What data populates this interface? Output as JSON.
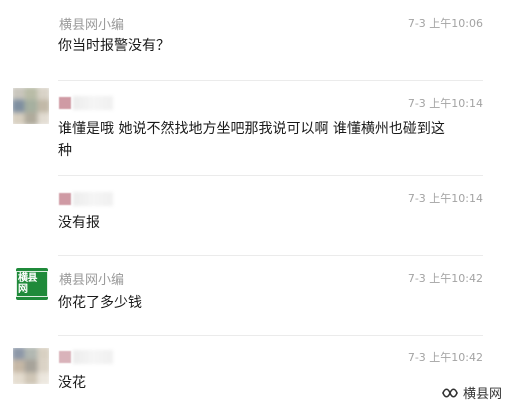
{
  "comments": [
    {
      "author": "横县网小编",
      "author_blurred": false,
      "time": "7-3 上午10:06",
      "text": "你当时报警没有？",
      "avatar": "none"
    },
    {
      "author": "",
      "author_blurred": true,
      "time": "7-3 上午10:14",
      "text": "谁懂是哦  她说不然找地方坐吧那我说可以啊  谁懂横州也碰到这种",
      "avatar": "blurred-photo"
    },
    {
      "author": "",
      "author_blurred": true,
      "time": "7-3 上午10:14",
      "text": "没有报",
      "avatar": "none"
    },
    {
      "author": "横县网小编",
      "author_blurred": false,
      "time": "7-3 上午10:42",
      "text": "你花了多少钱",
      "avatar": "logo",
      "avatar_text": "横县网"
    },
    {
      "author": "",
      "author_blurred": true,
      "time": "7-3 上午10:42",
      "text": "没花",
      "avatar": "blurred-photo"
    }
  ],
  "watermark": {
    "label": "横县网",
    "icon": "wechat-channel-icon"
  },
  "colors": {
    "meta_text": "#9a9a9a",
    "body_text": "#1a1a1a",
    "logo_green": "#1f8a3a",
    "blurred_name": "#cf9aa4"
  }
}
